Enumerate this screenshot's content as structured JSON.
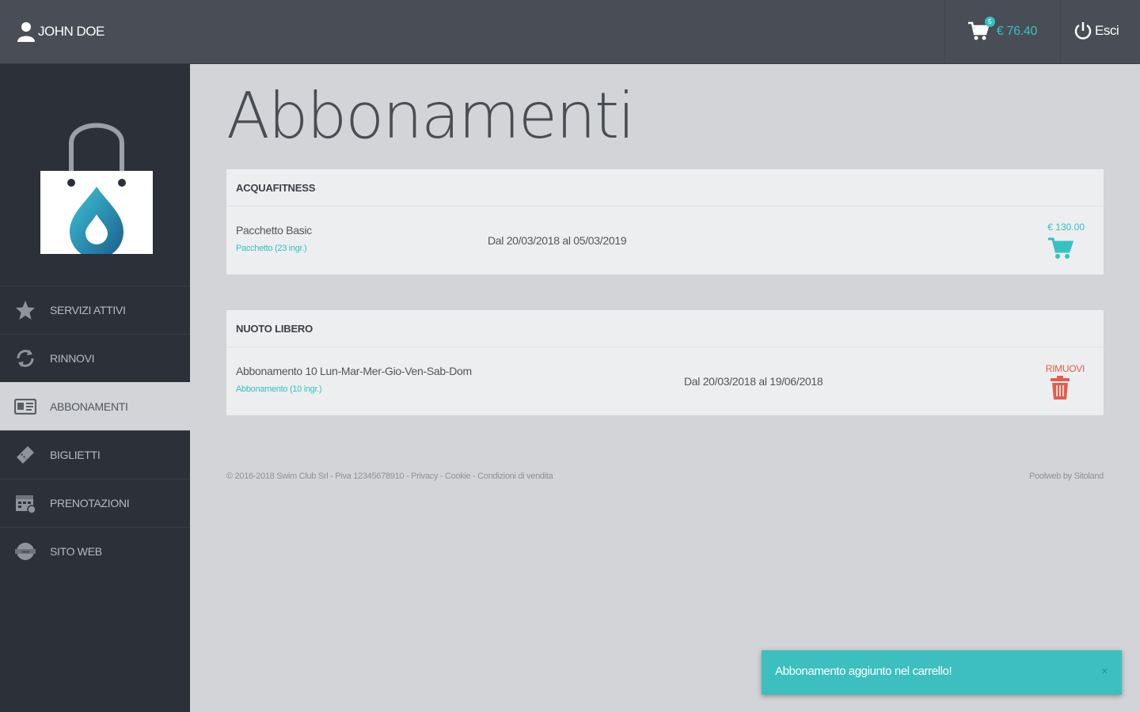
{
  "header": {
    "user_name": "JOHN DOE",
    "cart_count": "5",
    "cart_total": "€ 76.40",
    "logout_label": "Esci"
  },
  "sidebar": {
    "items": [
      {
        "label": "SERVIZI ATTIVI",
        "icon": "star-icon"
      },
      {
        "label": "RINNOVI",
        "icon": "refresh-icon"
      },
      {
        "label": "ABBONAMENTI",
        "icon": "id-card-icon",
        "active": true
      },
      {
        "label": "BIGLIETTI",
        "icon": "ticket-icon"
      },
      {
        "label": "PRENOTAZIONI",
        "icon": "calendar-icon"
      },
      {
        "label": "SITO WEB",
        "icon": "globe-icon"
      }
    ]
  },
  "main": {
    "title": "Abbonamenti",
    "sections": [
      {
        "heading": "ACQUAFITNESS",
        "item": {
          "name": "Pacchetto Basic",
          "subtitle": "Pacchetto (23 ingr.)",
          "dates": "Dal 20/03/2018 al 05/03/2019",
          "price": "€ 130.00",
          "action": "add-to-cart"
        }
      },
      {
        "heading": "NUOTO LIBERO",
        "item": {
          "name": "Abbonamento 10 Lun-Mar-Mer-Gio-Ven-Sab-Dom",
          "subtitle": "Abbonamento (10 ingr.)",
          "dates": "Dal 20/03/2018 al 19/06/2018",
          "remove_label": "RIMUOVI",
          "action": "remove"
        }
      }
    ]
  },
  "footer": {
    "left": "© 2016-2018 Swim Club Srl - Piva 12345678910 - Privacy - Cookie - Condizioni di vendita",
    "right": "Poolweb by Sitoland"
  },
  "toast": {
    "message": "Abbonamento aggiunto nel carrello!",
    "close": "×"
  },
  "colors": {
    "accent": "#35c2c1",
    "danger": "#e25d4c",
    "topbar": "#494d55",
    "sidebar": "#2c3039",
    "background": "#d2d4d7"
  }
}
